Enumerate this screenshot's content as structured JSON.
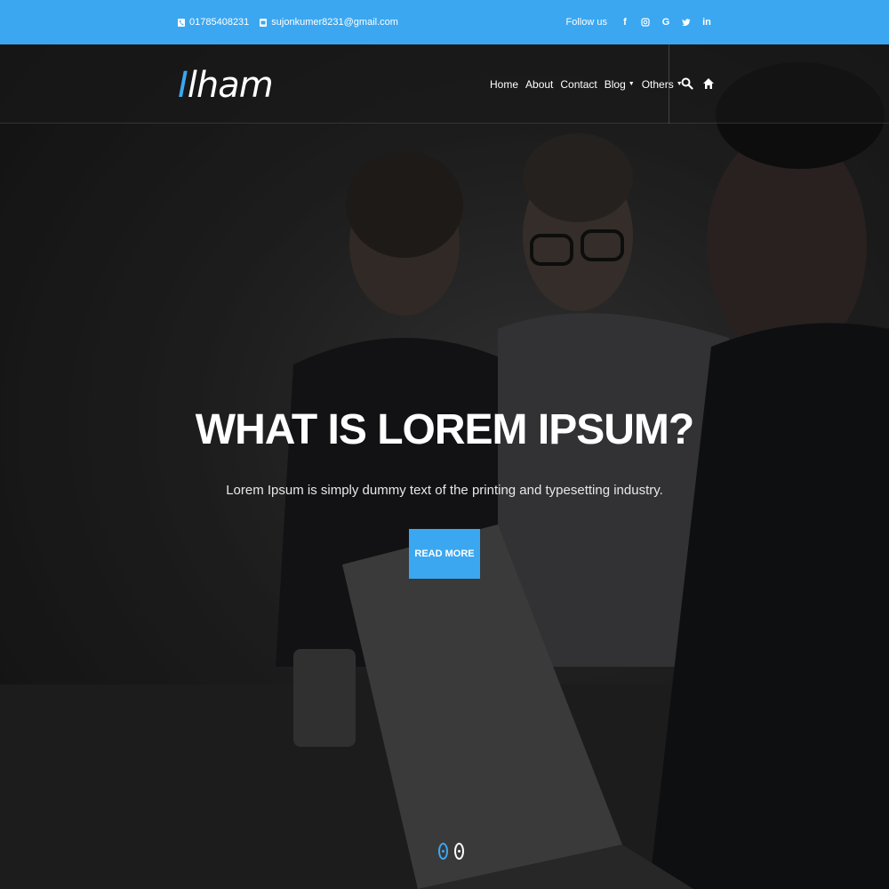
{
  "topbar": {
    "phone": "01785408231",
    "email": "sujonkumer8231@gmail.com",
    "follow_label": "Follow us",
    "social": [
      "facebook-icon",
      "instagram-icon",
      "google-icon",
      "twitter-icon",
      "linkedin-icon"
    ]
  },
  "nav": {
    "logo_accent": "I",
    "logo_rest": "lham",
    "items": [
      {
        "label": "Home"
      },
      {
        "label": "About"
      },
      {
        "label": "Contact"
      },
      {
        "label": "Blog"
      },
      {
        "label": "Others"
      }
    ]
  },
  "hero": {
    "title": "WHAT IS LOREM IPSUM?",
    "subtitle": "Lorem Ipsum is simply dummy text of the printing and typesetting industry.",
    "cta_label": "READ MORE",
    "slides": 2,
    "active_slide": 2
  },
  "colors": {
    "accent": "#3ba7f0",
    "nav_bg": "#1e1e1e",
    "text": "#ffffff"
  }
}
